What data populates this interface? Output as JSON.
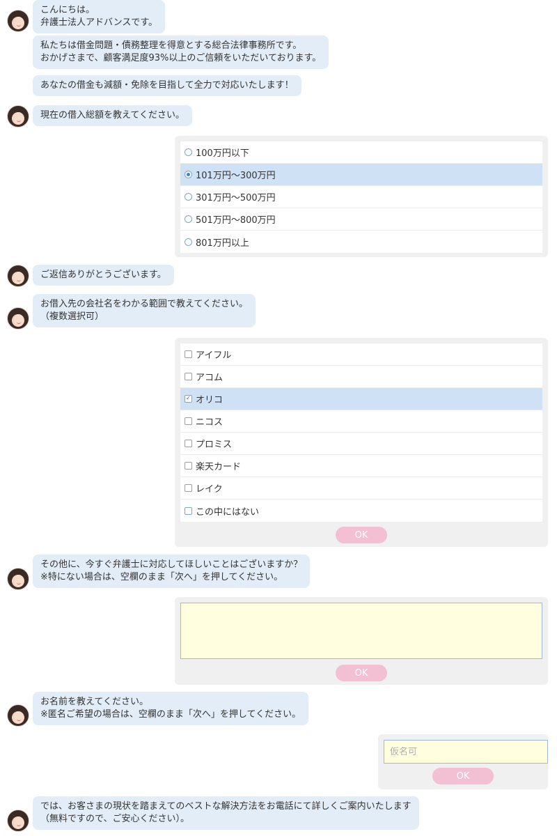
{
  "messages": {
    "m1": "こんにちは。\n弁護士法人アドバンスです。",
    "m2": "私たちは借金問題・債務整理を得意とする総合法律事務所です。\nおかげさまで、顧客満足度93%以上のご信頼をいただいております。",
    "m3": "あなたの借金も減額・免除を目指して全力で対応いたします！",
    "m4": "現在の借入総額を教えてください。",
    "m5": "ご返信ありがとうございます。",
    "m6": "お借入先の会社名をわかる範囲で教えてください。\n（複数選択可）",
    "m7": "その他に、今すぐ弁護士に対応してほしいことはございますか？\n※特にない場合は、空欄のまま「次へ」を押してください。",
    "m8": "お名前を教えてください。\n※匿名ご希望の場合は、空欄のまま「次へ」を押してください。",
    "m9": "では、お客さまの現状を踏まえてのベストな解決方法をお電話にて詳しくご案内いたします\n（無料ですので、ご安心ください）。"
  },
  "debt_options": [
    "100万円以下",
    "101万円〜300万円",
    "301万円〜500万円",
    "501万円〜800万円",
    "801万円以上"
  ],
  "debt_selected": "101万円〜300万円",
  "lender_options": [
    "アイフル",
    "アコム",
    "オリコ",
    "ニコス",
    "プロミス",
    "楽天カード",
    "レイク",
    "この中にはない"
  ],
  "lender_checked": [
    "オリコ"
  ],
  "other_request": {
    "value": ""
  },
  "name_field": {
    "value": "",
    "placeholder": "仮名可"
  },
  "ok_label": "OK",
  "colors": {
    "bubble": "#e2edf7",
    "selected": "#cfe1f4",
    "ok_button": "#f2c0d2",
    "input_bg": "#ffffe0"
  }
}
